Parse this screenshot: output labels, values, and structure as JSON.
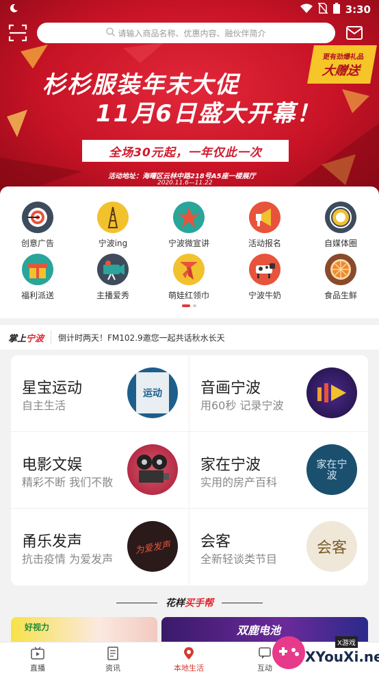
{
  "status_bar": {
    "time": "3:30"
  },
  "search": {
    "placeholder": "请输入商品名称、优惠内容、融伙伴简介"
  },
  "banner": {
    "title_line1": "杉杉服装年末大促",
    "title_line2": "11月6日盛大开幕！",
    "subtitle": "全场30元起，一年仅此一次",
    "address": "活动地址：海曙区云林中路218号A5座一楼展厅",
    "dates": "2020.11.6—11.22",
    "gift_line1": "更有劲爆礼品",
    "gift_line2": "大赠送"
  },
  "grid": {
    "items": [
      {
        "label": "创意广告",
        "icon": "target-icon",
        "color": "#3d4b5c"
      },
      {
        "label": "宁波ing",
        "icon": "tower-icon",
        "color": "#f2c12e"
      },
      {
        "label": "宁波微宣讲",
        "icon": "star-icon",
        "color": "#2aa59a"
      },
      {
        "label": "活动报名",
        "icon": "megaphone-icon",
        "color": "#e8533c"
      },
      {
        "label": "自媒体圈",
        "icon": "media-icon",
        "color": "#3d4b5c"
      },
      {
        "label": "福利派送",
        "icon": "gift-icon",
        "color": "#2aa59a"
      },
      {
        "label": "主播爱秀",
        "icon": "camera-icon",
        "color": "#3d4b5c"
      },
      {
        "label": "萌娃红领巾",
        "icon": "scarf-icon",
        "color": "#f2c12e"
      },
      {
        "label": "宁波牛奶",
        "icon": "cow-icon",
        "color": "#e8533c"
      },
      {
        "label": "食品生鲜",
        "icon": "orange-icon",
        "color": "#8a4a2b"
      }
    ]
  },
  "ticker": {
    "brand_left": "掌上",
    "brand_right": "宁波",
    "text": "倒计时两天！FM102.9邀您一起共话秋水长天"
  },
  "programs": [
    {
      "title": "星宝运动",
      "subtitle": "自主生活",
      "thumb_text": "运动"
    },
    {
      "title": "音画宁波",
      "subtitle": "用60秒 记录宁波",
      "thumb_text": ""
    },
    {
      "title": "电影文娱",
      "subtitle": "精彩不断 我们不散",
      "thumb_text": ""
    },
    {
      "title": "家在宁波",
      "subtitle": "实用的房产百科",
      "thumb_text": "家在宁波"
    },
    {
      "title": "甬乐发声",
      "subtitle": "抗击疫情 为爱发声",
      "thumb_text": "为爱发声"
    },
    {
      "title": "会客",
      "subtitle": "全新轻谈类节目",
      "thumb_text": "会客"
    }
  ],
  "section": {
    "title_left": "花样",
    "title_right": "买手帮"
  },
  "promos": [
    {
      "text": "好视力"
    },
    {
      "text": "双鹿电池"
    }
  ],
  "bottom_nav": [
    {
      "label": "直播",
      "icon": "tv-icon"
    },
    {
      "label": "资讯",
      "icon": "news-icon"
    },
    {
      "label": "本地生活",
      "icon": "location-icon"
    },
    {
      "label": "互动",
      "icon": "chat-icon"
    }
  ],
  "watermark": {
    "text": "XYouXi.net",
    "badge": "X游戏"
  }
}
